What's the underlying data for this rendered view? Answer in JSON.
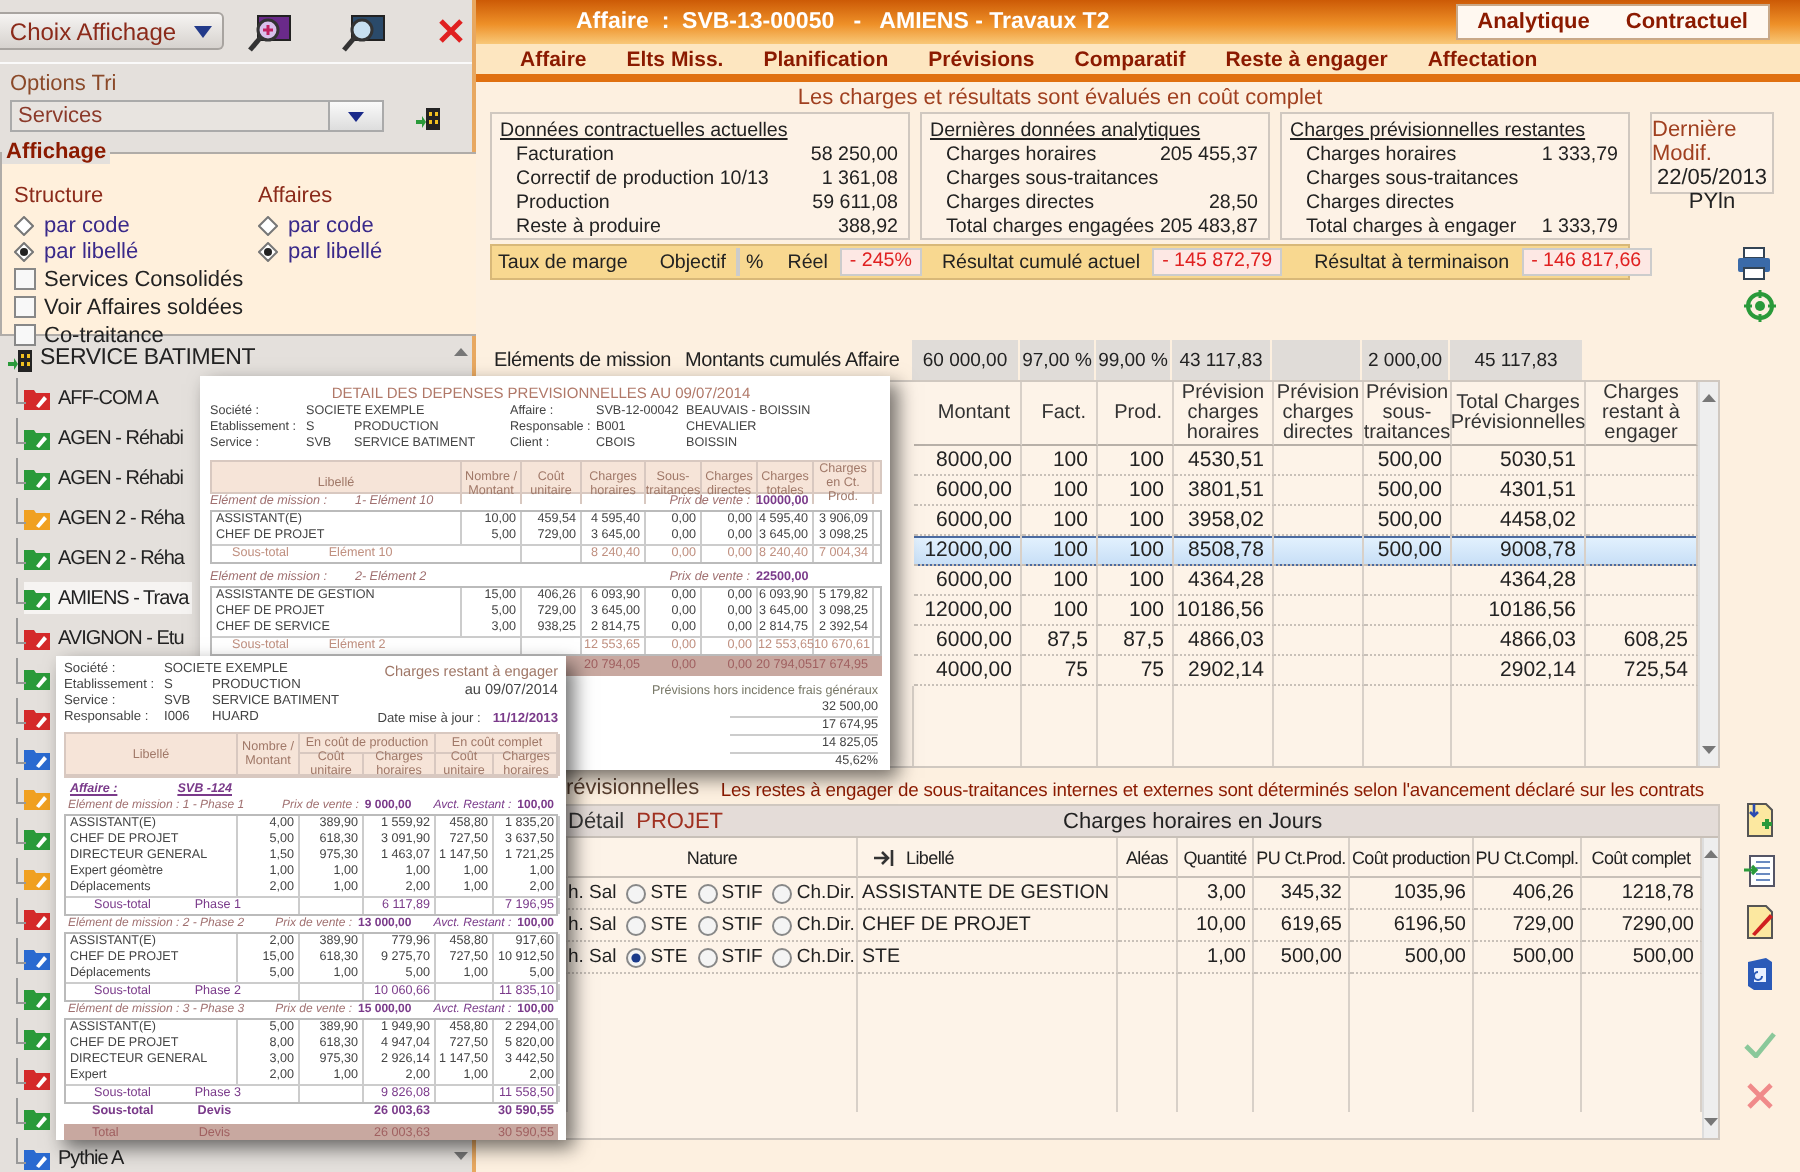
{
  "sidebar": {
    "display_button": {
      "label": "Choix Affichage"
    },
    "sort": {
      "title": "Options Tri",
      "value": "Services"
    },
    "display": {
      "title": "Affichage",
      "groups": [
        {
          "title": "Structure",
          "options": [
            {
              "label": "par code",
              "selected": false
            },
            {
              "label": "par libellé",
              "selected": true
            }
          ]
        },
        {
          "title": "Affaires",
          "options": [
            {
              "label": "par code",
              "selected": false
            },
            {
              "label": "par libellé",
              "selected": true
            }
          ]
        }
      ],
      "checks": [
        {
          "label": "Services Consolidés",
          "checked": false
        },
        {
          "label": "Voir Affaires soldées",
          "checked": false
        },
        {
          "label": "Co-traitance",
          "checked": false
        }
      ]
    },
    "tree": {
      "label": "SERVICE BATIMENT",
      "children": [
        {
          "label": "AFF-COM A",
          "color": "#d42a2a",
          "selected": false
        },
        {
          "label": "AGEN - Réhabi",
          "color": "#2a9a3a",
          "selected": false
        },
        {
          "label": "AGEN - Réhabi",
          "color": "#2a9a3a",
          "selected": false
        },
        {
          "label": "AGEN 2 - Réha",
          "color": "#f0a020",
          "selected": false
        },
        {
          "label": "AGEN 2 - Réha",
          "color": "#2a9a3a",
          "selected": false
        },
        {
          "label": "AMIENS - Trava",
          "color": "#2a9a3a",
          "selected": true
        },
        {
          "label": "AVIGNON - Etu",
          "color": "#d42a2a",
          "selected": false
        },
        {
          "color": "#2a9a3a",
          "selected": false
        },
        {
          "color": "#d42a2a",
          "selected": false
        },
        {
          "color": "#2a6ad0",
          "selected": false
        },
        {
          "color": "#f0a020",
          "selected": false
        },
        {
          "color": "#2a9a3a",
          "selected": false
        },
        {
          "color": "#f0a020",
          "selected": false
        },
        {
          "color": "#d42a2a",
          "selected": false
        },
        {
          "color": "#2a6ad0",
          "selected": false
        },
        {
          "color": "#2a9a3a",
          "selected": false
        },
        {
          "color": "#2a9a3a",
          "selected": false
        },
        {
          "color": "#d42a2a",
          "selected": false
        },
        {
          "color": "#2a9a3a",
          "selected": false
        },
        {
          "label": "Pythie A",
          "color": "#2a6ad0",
          "selected": false
        }
      ]
    }
  },
  "header": {
    "title": "Affaire  :  SVB-13-00050   -   AMIENS - Travaux T2",
    "views": [
      "Analytique",
      "Contractuel"
    ],
    "tabs": [
      "Affaire",
      "Elts Miss.",
      "Planification",
      "Prévisions",
      "Comparatif",
      "Reste à engager",
      "Affectation"
    ]
  },
  "notice": "Les charges et résultats sont évalués en coût complet",
  "summary": [
    {
      "title": "Données contractuelles actuelles",
      "rows": [
        {
          "label": "Facturation",
          "value": "58 250,00"
        },
        {
          "label": "Correctif de production 10/13",
          "value": "1 361,08"
        },
        {
          "label": "Production",
          "value": "59 611,08"
        },
        {
          "label": "Reste à produire",
          "value": "388,92"
        }
      ]
    },
    {
      "title": "Dernières données analytiques",
      "rows": [
        {
          "label": "Charges horaires",
          "value": "205 455,37"
        },
        {
          "label": "Charges sous-traitances"
        },
        {
          "label": "Charges directes",
          "value": "28,50"
        },
        {
          "label": "Total charges engagées",
          "value": "205 483,87"
        }
      ]
    },
    {
      "title": "Charges prévisionnelles restantes",
      "rows": [
        {
          "label": "Charges horaires",
          "value": "1 333,79"
        },
        {
          "label": "Charges sous-traitances"
        },
        {
          "label": "Charges directes"
        },
        {
          "label": "Total charges à engager",
          "value": "1 333,79"
        }
      ]
    }
  ],
  "last_modified": {
    "title": "Dernière Modif.",
    "date": "22/05/2013",
    "user": "PYln"
  },
  "margin": {
    "label": "Taux de marge",
    "target_label": "Objectif",
    "target_unit": "%",
    "actual_label": "Réel",
    "actual": "- 245%",
    "cumulative_label": "Résultat cumulé actuel",
    "cumulative": "- 145 872,79",
    "final_label": "Résultat à terminaison",
    "final": "- 146 817,66"
  },
  "missions": {
    "title": "Eléments de mission",
    "totals_label": "Montants cumulés Affaire",
    "columns": [
      {
        "header": "Montant",
        "shaded": true,
        "total": "60 000,00"
      },
      {
        "header": "Fact.",
        "shaded": true,
        "total": "97,00 %"
      },
      {
        "header": "Prod.",
        "shaded": true,
        "total": "99,00 %"
      },
      {
        "header": "Prévision charges horaires",
        "shaded": true,
        "total": "43 117,83"
      },
      {
        "header": "Prévision charges directes",
        "shaded": true
      },
      {
        "header": "Prévision sous-traitances",
        "shaded": true,
        "total": "2 000,00"
      },
      {
        "header": "Total Charges Prévisionnelles",
        "shaded": true,
        "total": "45 117,83"
      },
      {
        "header": "Charges restant à engager",
        "shaded": false
      }
    ],
    "rows": [
      {
        "selected": false,
        "cells": [
          "8000,00",
          "100",
          "100",
          "4530,51",
          null,
          "500,00",
          "5030,51",
          null
        ]
      },
      {
        "selected": false,
        "cells": [
          "6000,00",
          "100",
          "100",
          "3801,51",
          null,
          "500,00",
          "4301,51",
          null
        ]
      },
      {
        "selected": false,
        "cells": [
          "6000,00",
          "100",
          "100",
          "3958,02",
          null,
          "500,00",
          "4458,02",
          null
        ]
      },
      {
        "selected": true,
        "cells": [
          "12000,00",
          "100",
          "100",
          "8508,78",
          null,
          "500,00",
          "9008,78",
          null
        ]
      },
      {
        "selected": false,
        "cells": [
          "6000,00",
          "100",
          "100",
          "4364,28",
          null,
          null,
          "4364,28",
          null
        ]
      },
      {
        "selected": false,
        "cells": [
          "12000,00",
          "100",
          "100",
          "10186,56",
          null,
          null,
          "10186,56",
          null
        ]
      },
      {
        "selected": false,
        "cells": [
          "6000,00",
          "87,5",
          "87,5",
          "4866,03",
          null,
          null,
          "4866,03",
          "608,25"
        ]
      },
      {
        "selected": false,
        "cells": [
          "4000,00",
          "75",
          "75",
          "2902,14",
          null,
          null,
          "2902,14",
          "725,54"
        ]
      }
    ]
  },
  "contracts": {
    "caption": "révisionnelles",
    "note": "Les restes à engager de sous-traitances internes et externes sont déterminés selon l'avancement déclaré sur les contrats",
    "detail_label": "Détail",
    "detail_value": "PROJET",
    "unit_title": "Charges horaires en Jours",
    "columns": [
      "Nature",
      "Libellé",
      "Aléas",
      "Quantité",
      "PU Ct.Prod.",
      "Coût production",
      "PU Ct.Compl.",
      "Coût complet"
    ],
    "rows": [
      {
        "type": "h. Sal",
        "nature": [
          {
            "label": "STE",
            "selected": false
          },
          {
            "label": "STIF",
            "selected": false
          },
          {
            "label": "Ch.Dir.",
            "selected": false
          }
        ],
        "label": "ASSISTANTE DE GESTION",
        "values": [
          "3,00",
          "345,32",
          "1035,96",
          "406,26",
          "1218,78"
        ]
      },
      {
        "type": "h. Sal",
        "nature": [
          {
            "label": "STE",
            "selected": false
          },
          {
            "label": "STIF",
            "selected": false
          },
          {
            "label": "Ch.Dir.",
            "selected": false
          }
        ],
        "label": "CHEF DE PROJET",
        "values": [
          "10,00",
          "619,65",
          "6196,50",
          "729,00",
          "7290,00"
        ]
      },
      {
        "type": "h. Sal",
        "nature": [
          {
            "label": "STE",
            "selected": true
          },
          {
            "label": "STIF",
            "selected": false
          },
          {
            "label": "Ch.Dir.",
            "selected": false
          }
        ],
        "label": "STE",
        "values": [
          "1,00",
          "500,00",
          "500,00",
          "500,00",
          "500,00"
        ]
      }
    ]
  },
  "doc_detail": {
    "title": "DETAIL DES DEPENSES PREVISIONNELLES AU 09/07/2014",
    "info_left": [
      [
        "Société :",
        "SOCIETE EXEMPLE"
      ],
      [
        "Etablissement :",
        "S",
        "PRODUCTION"
      ],
      [
        "Service :",
        "SVB",
        "SERVICE BATIMENT"
      ]
    ],
    "info_right": [
      [
        "Affaire :",
        "SVB-12-00042",
        "BEAUVAIS - BOISSIN"
      ],
      [
        "Responsable :",
        "B001",
        "CHEVALIER"
      ],
      [
        "Client :",
        "CBOIS",
        "BOISSIN"
      ]
    ],
    "columns": [
      "Libellé",
      "Nombre / Montant",
      "Coût unitaire",
      "Charges horaires",
      "Sous-traitances",
      "Charges directes",
      "Charges totales",
      "Charges en Ct. Prod."
    ],
    "sections": [
      {
        "label": "Elément de mission :",
        "name": "1- Elément 10",
        "price_label": "Prix de vente :",
        "price": "10000,00",
        "rows": [
          [
            "ASSISTANT(E)",
            "10,00",
            "459,54",
            "4 595,40",
            "0,00",
            "0,00",
            "4 595,40",
            "3 906,09"
          ],
          [
            "CHEF DE PROJET",
            "5,00",
            "729,00",
            "3 645,00",
            "0,00",
            "0,00",
            "3 645,00",
            "3 098,25"
          ]
        ],
        "subtotal": [
          "Sous-total",
          "Elément 10",
          "8 240,40",
          "0,00",
          "0,00",
          "8 240,40",
          "7 004,34"
        ]
      },
      {
        "label": "Elément de mission :",
        "name": "2- Elément 2",
        "price_label": "Prix de vente :",
        "price": "22500,00",
        "rows": [
          [
            "ASSISTANTE DE GESTION",
            "15,00",
            "406,26",
            "6 093,90",
            "0,00",
            "0,00",
            "6 093,90",
            "5 179,82"
          ],
          [
            "CHEF DE PROJET",
            "5,00",
            "729,00",
            "3 645,00",
            "0,00",
            "0,00",
            "3 645,00",
            "3 098,25"
          ],
          [
            "CHEF DE SERVICE",
            "3,00",
            "938,25",
            "2 814,75",
            "0,00",
            "0,00",
            "2 814,75",
            "2 392,54"
          ]
        ],
        "subtotal": [
          "Sous-total",
          "Elément 2",
          "12 553,65",
          "0,00",
          "0,00",
          "12 553,65",
          "10 670,61"
        ]
      }
    ],
    "total": [
      "20 794,05",
      "0,00",
      "0,00",
      "20 794,05",
      "17 674,95"
    ],
    "forecast": {
      "title": "Prévisions hors incidence frais généraux",
      "values": [
        "32 500,00",
        "17 674,95",
        "14 825,05",
        "45,62%"
      ]
    }
  },
  "doc_remaining": {
    "title": "Charges restant à engager",
    "date": "au 09/07/2014",
    "info": [
      [
        "Société :",
        "SOCIETE EXEMPLE"
      ],
      [
        "Etablissement :",
        "S",
        "PRODUCTION"
      ],
      [
        "Service :",
        "SVB",
        "SERVICE BATIMENT"
      ],
      [
        "Responsable :",
        "I006",
        "HUARD"
      ]
    ],
    "update_label": "Date mise à jour :",
    "update": "11/12/2013",
    "groups": [
      "En coût de production",
      "En coût complet"
    ],
    "columns": [
      "Libellé",
      "Nombre / Montant",
      "Coût unitaire",
      "Charges horaires",
      "Coût unitaire",
      "Charges horaires"
    ],
    "affaire_label": "Affaire :",
    "affaire": "SVB -124",
    "sections": [
      {
        "label": "Elément de mission : 1 - Phase 1",
        "price_label": "Prix de vente :",
        "price": "9 000,00",
        "rest_label": "Avct. Restant :",
        "rest": "100,00",
        "rows": [
          [
            "ASSISTANT(E)",
            "4,00",
            "389,90",
            "1 559,92",
            "458,80",
            "1 835,20"
          ],
          [
            "CHEF DE PROJET",
            "5,00",
            "618,30",
            "3 091,90",
            "727,50",
            "3 637,50"
          ],
          [
            "DIRECTEUR GENERAL",
            "1,50",
            "975,30",
            "1 463,07",
            "1 147,50",
            "1 721,25"
          ],
          [
            "Expert géomètre",
            "1,00",
            "1,00",
            "1,00",
            "1,00",
            "1,00"
          ],
          [
            "Déplacements",
            "2,00",
            "1,00",
            "2,00",
            "1,00",
            "2,00"
          ]
        ],
        "subtotal": [
          "Sous-total",
          "Phase 1",
          "6 117,89",
          "7 196,95"
        ]
      },
      {
        "label": "Elément de mission : 2 - Phase 2",
        "price_label": "Prix de vente :",
        "price": "13 000,00",
        "rest_label": "Avct. Restant :",
        "rest": "100,00",
        "rows": [
          [
            "ASSISTANT(E)",
            "2,00",
            "389,90",
            "779,96",
            "458,80",
            "917,60"
          ],
          [
            "CHEF DE PROJET",
            "15,00",
            "618,30",
            "9 275,70",
            "727,50",
            "10 912,50"
          ],
          [
            "Déplacements",
            "5,00",
            "1,00",
            "5,00",
            "1,00",
            "5,00"
          ]
        ],
        "subtotal": [
          "Sous-total",
          "Phase 2",
          "10 060,66",
          "11 835,10"
        ]
      },
      {
        "label": "Elément de mission : 3 - Phase 3",
        "price_label": "Prix de vente :",
        "price": "15 000,00",
        "rest_label": "Avct. Restant :",
        "rest": "100,00",
        "rows": [
          [
            "ASSISTANT(E)",
            "5,00",
            "389,90",
            "1 949,90",
            "458,80",
            "2 294,00"
          ],
          [
            "CHEF DE PROJET",
            "8,00",
            "618,30",
            "4 947,04",
            "727,50",
            "5 820,00"
          ],
          [
            "DIRECTEUR GENERAL",
            "3,00",
            "975,30",
            "2 926,14",
            "1 147,50",
            "3 442,50"
          ],
          [
            "Expert",
            "2,00",
            "1,00",
            "2,00",
            "1,00",
            "2,00"
          ]
        ],
        "subtotal": [
          "Sous-total",
          "Phase 3",
          "9 826,08",
          "11 558,50"
        ]
      }
    ],
    "devis": [
      "Sous-total",
      "Devis",
      "26 003,63",
      "30 590,55"
    ],
    "total": [
      "Total",
      "Devis",
      "26 003,63",
      "30 590,55"
    ]
  }
}
